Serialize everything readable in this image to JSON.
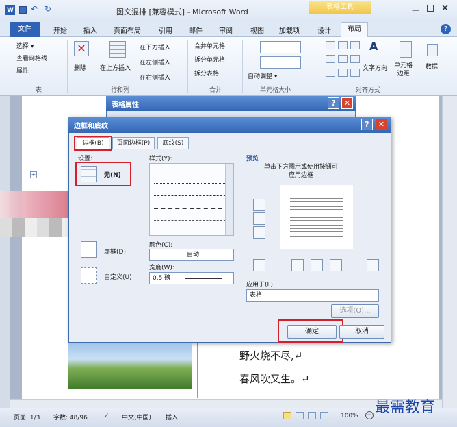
{
  "window": {
    "title": "图文混排 [兼容模式] - Microsoft Word",
    "context_tab": "表格工具"
  },
  "ribbon_tabs": [
    "文件",
    "开始",
    "插入",
    "页面布局",
    "引用",
    "邮件",
    "审阅",
    "视图",
    "加载项",
    "设计",
    "布局"
  ],
  "ribbon": {
    "table_group": {
      "items": [
        "选择 ▾",
        "查看网格线",
        "属性"
      ],
      "label": "表"
    },
    "delete_label": "删除",
    "rows_cols": {
      "insert_above": "在上方插入",
      "insert_below": "在下方插入",
      "insert_left": "在左侧插入",
      "insert_right": "在右侧插入",
      "label": "行和列"
    },
    "merge": {
      "merge_cells": "合并单元格",
      "split_cells": "拆分单元格",
      "split_table": "拆分表格",
      "label": "合并"
    },
    "cell_size": {
      "autofit": "自动调整 ▾",
      "label": "单元格大小"
    },
    "alignment": {
      "text_direction": "文字方向",
      "cell_margins": "单元格\n边距",
      "label": "对齐方式"
    },
    "data_label": "数据"
  },
  "table_props_dialog": {
    "title": "表格属性"
  },
  "borders_dialog": {
    "title": "边框和底纹",
    "tabs": [
      "边框(B)",
      "页面边框(P)",
      "底纹(S)"
    ],
    "setting_label": "设置:",
    "settings": [
      "无(N)",
      "虚框(D)",
      "自定义(U)"
    ],
    "style_label": "样式(Y):",
    "color_label": "颜色(C):",
    "color_value": "自动",
    "width_label": "宽度(W):",
    "width_value": "0.5 磅",
    "preview_label": "预览",
    "preview_hint": "单击下方图示或使用按钮可\n应用边框",
    "apply_to_label": "应用于(L):",
    "apply_to_value": "表格",
    "options_button": "选项(O)...",
    "ok_button": "确定",
    "cancel_button": "取消"
  },
  "document": {
    "poem_lines": [
      "野火烧不尽,↵",
      "春风吹又生。↵"
    ]
  },
  "status_bar": {
    "page": "页面: 1/3",
    "words": "字数: 48/96",
    "language": "中文(中国)",
    "mode": "插入",
    "zoom": "100%"
  },
  "watermark": "最需教育"
}
